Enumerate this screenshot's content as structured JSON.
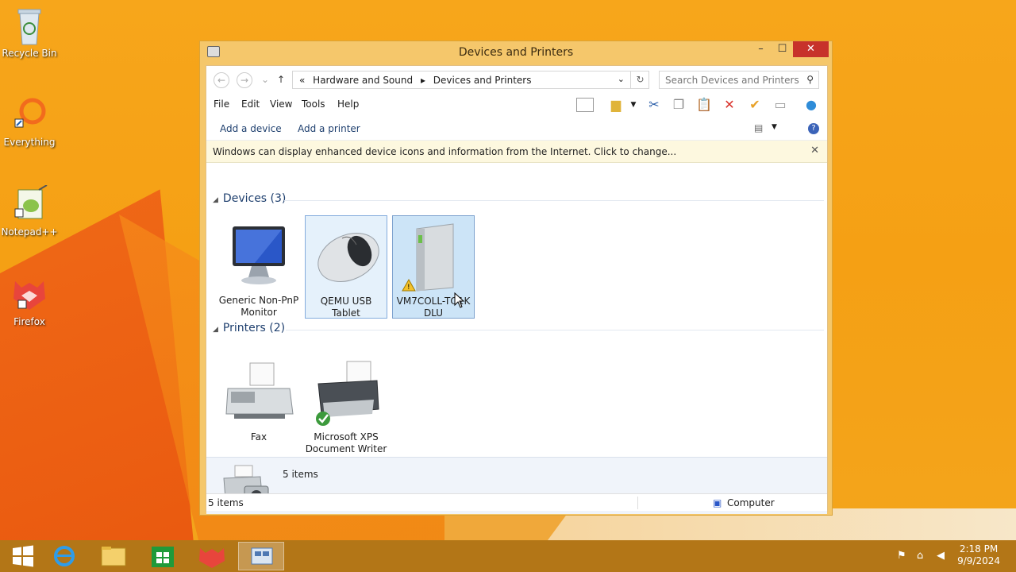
{
  "desktop": {
    "icons": [
      {
        "label": "Recycle Bin"
      },
      {
        "label": "Everything"
      },
      {
        "label": "Notepad++"
      },
      {
        "label": "Firefox"
      }
    ]
  },
  "window": {
    "title": "Devices and Printers",
    "controls": {
      "minimize": "–",
      "maximize": "☐",
      "close": "✕"
    },
    "breadcrumbs": [
      "«",
      "Hardware and Sound",
      "▸",
      "Devices and Printers"
    ],
    "search_placeholder": "Search Devices and Printers",
    "menu": [
      "File",
      "Edit",
      "View",
      "Tools",
      "Help"
    ],
    "commands": {
      "add_device": "Add a device",
      "add_printer": "Add a printer"
    },
    "infobar": "Windows can display enhanced device icons and information from the Internet. Click to change...",
    "groups": {
      "devices": {
        "title": "Devices (3)",
        "items": [
          {
            "label": "Generic Non-PnP Monitor"
          },
          {
            "label": "QEMU USB Tablet"
          },
          {
            "label": "VM7COLL-TO1K DLU"
          }
        ]
      },
      "printers": {
        "title": "Printers (2)",
        "items": [
          {
            "label": "Fax"
          },
          {
            "label": "Microsoft XPS Document Writer"
          }
        ]
      }
    },
    "details_count": "5 items",
    "status": {
      "left": "5 items",
      "right": "Computer"
    }
  },
  "taskbar": {
    "time": "2:18 PM",
    "date": "9/9/2024"
  },
  "colors": {
    "accent": "#c7322b",
    "selection": "#cce4f7",
    "link": "#1e3f6e"
  }
}
